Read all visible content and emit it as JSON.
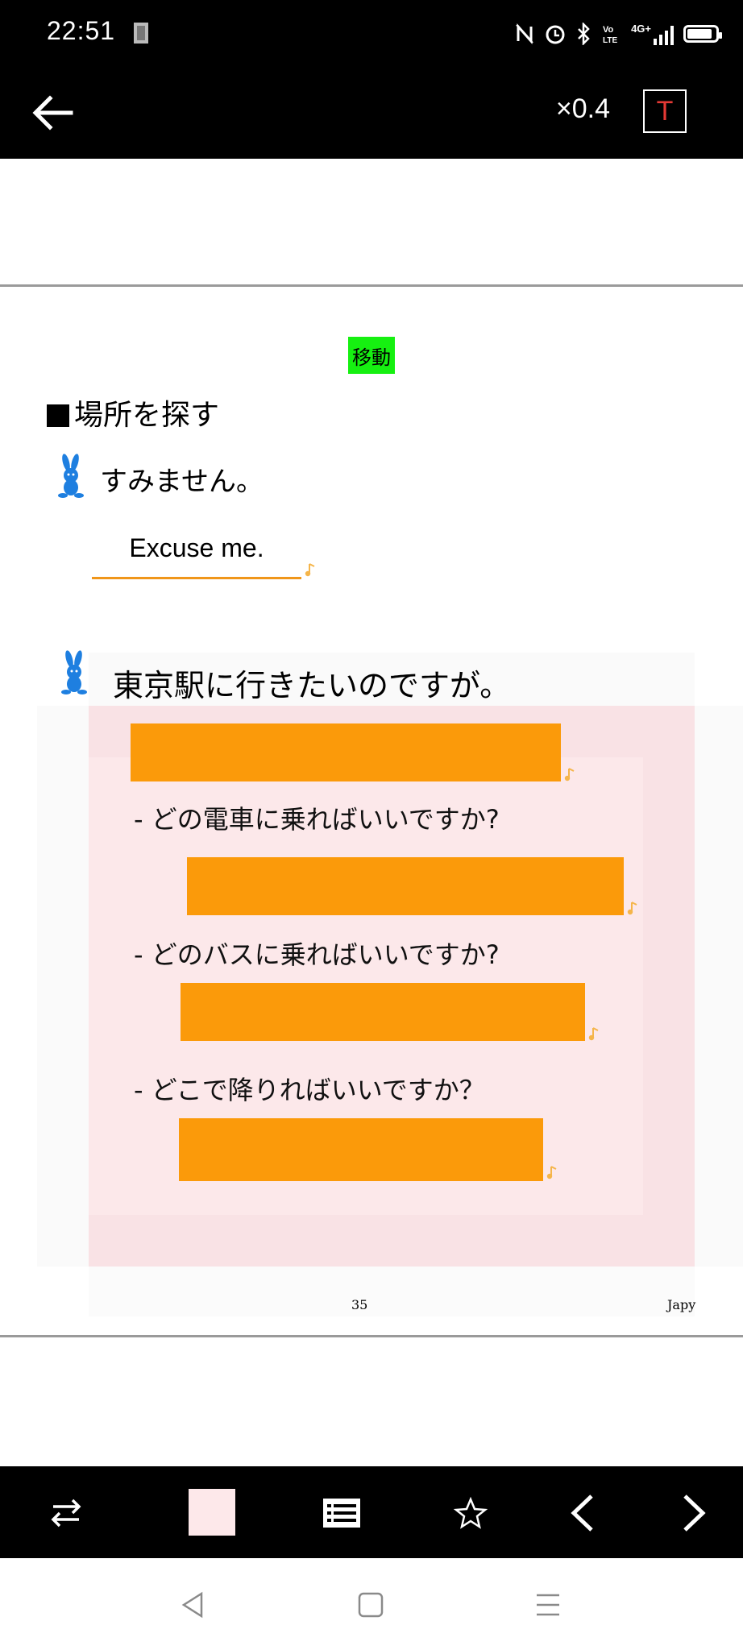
{
  "status_bar": {
    "time": "22:51",
    "network": "4G+"
  },
  "top_bar": {
    "zoom_label": "×0.4",
    "text_button_label": "T"
  },
  "content": {
    "badge_label": "移動",
    "section_title": "場所を探す",
    "phrase1": "すみません。",
    "phrase1_translation": "Excuse me.",
    "phrase2": "東京駅に行きたいのですが。",
    "questions": [
      "- どの電車に乗ればいいですか?",
      "- どのバスに乗ればいいですか?",
      "- どこで降りればいいですか？"
    ],
    "page_number": "35",
    "footer_brand": "Japy"
  },
  "colors": {
    "badge_green": "#16f011",
    "highlight_orange": "#fb9a0a",
    "underline_orange": "#f0961a",
    "pink_background": "#fce8ea",
    "rabbit_blue": "#1e7fe0",
    "t_button_red": "#e53935",
    "swatch_pink": "#fde8ea"
  },
  "bottom_toolbar": {
    "icons": [
      "swap-icon",
      "color-swatch",
      "list-icon",
      "star-icon",
      "chevron-left-icon",
      "chevron-right-icon"
    ]
  },
  "nav_bar": {
    "icons": [
      "nav-back-icon",
      "nav-home-icon",
      "nav-menu-icon"
    ]
  }
}
